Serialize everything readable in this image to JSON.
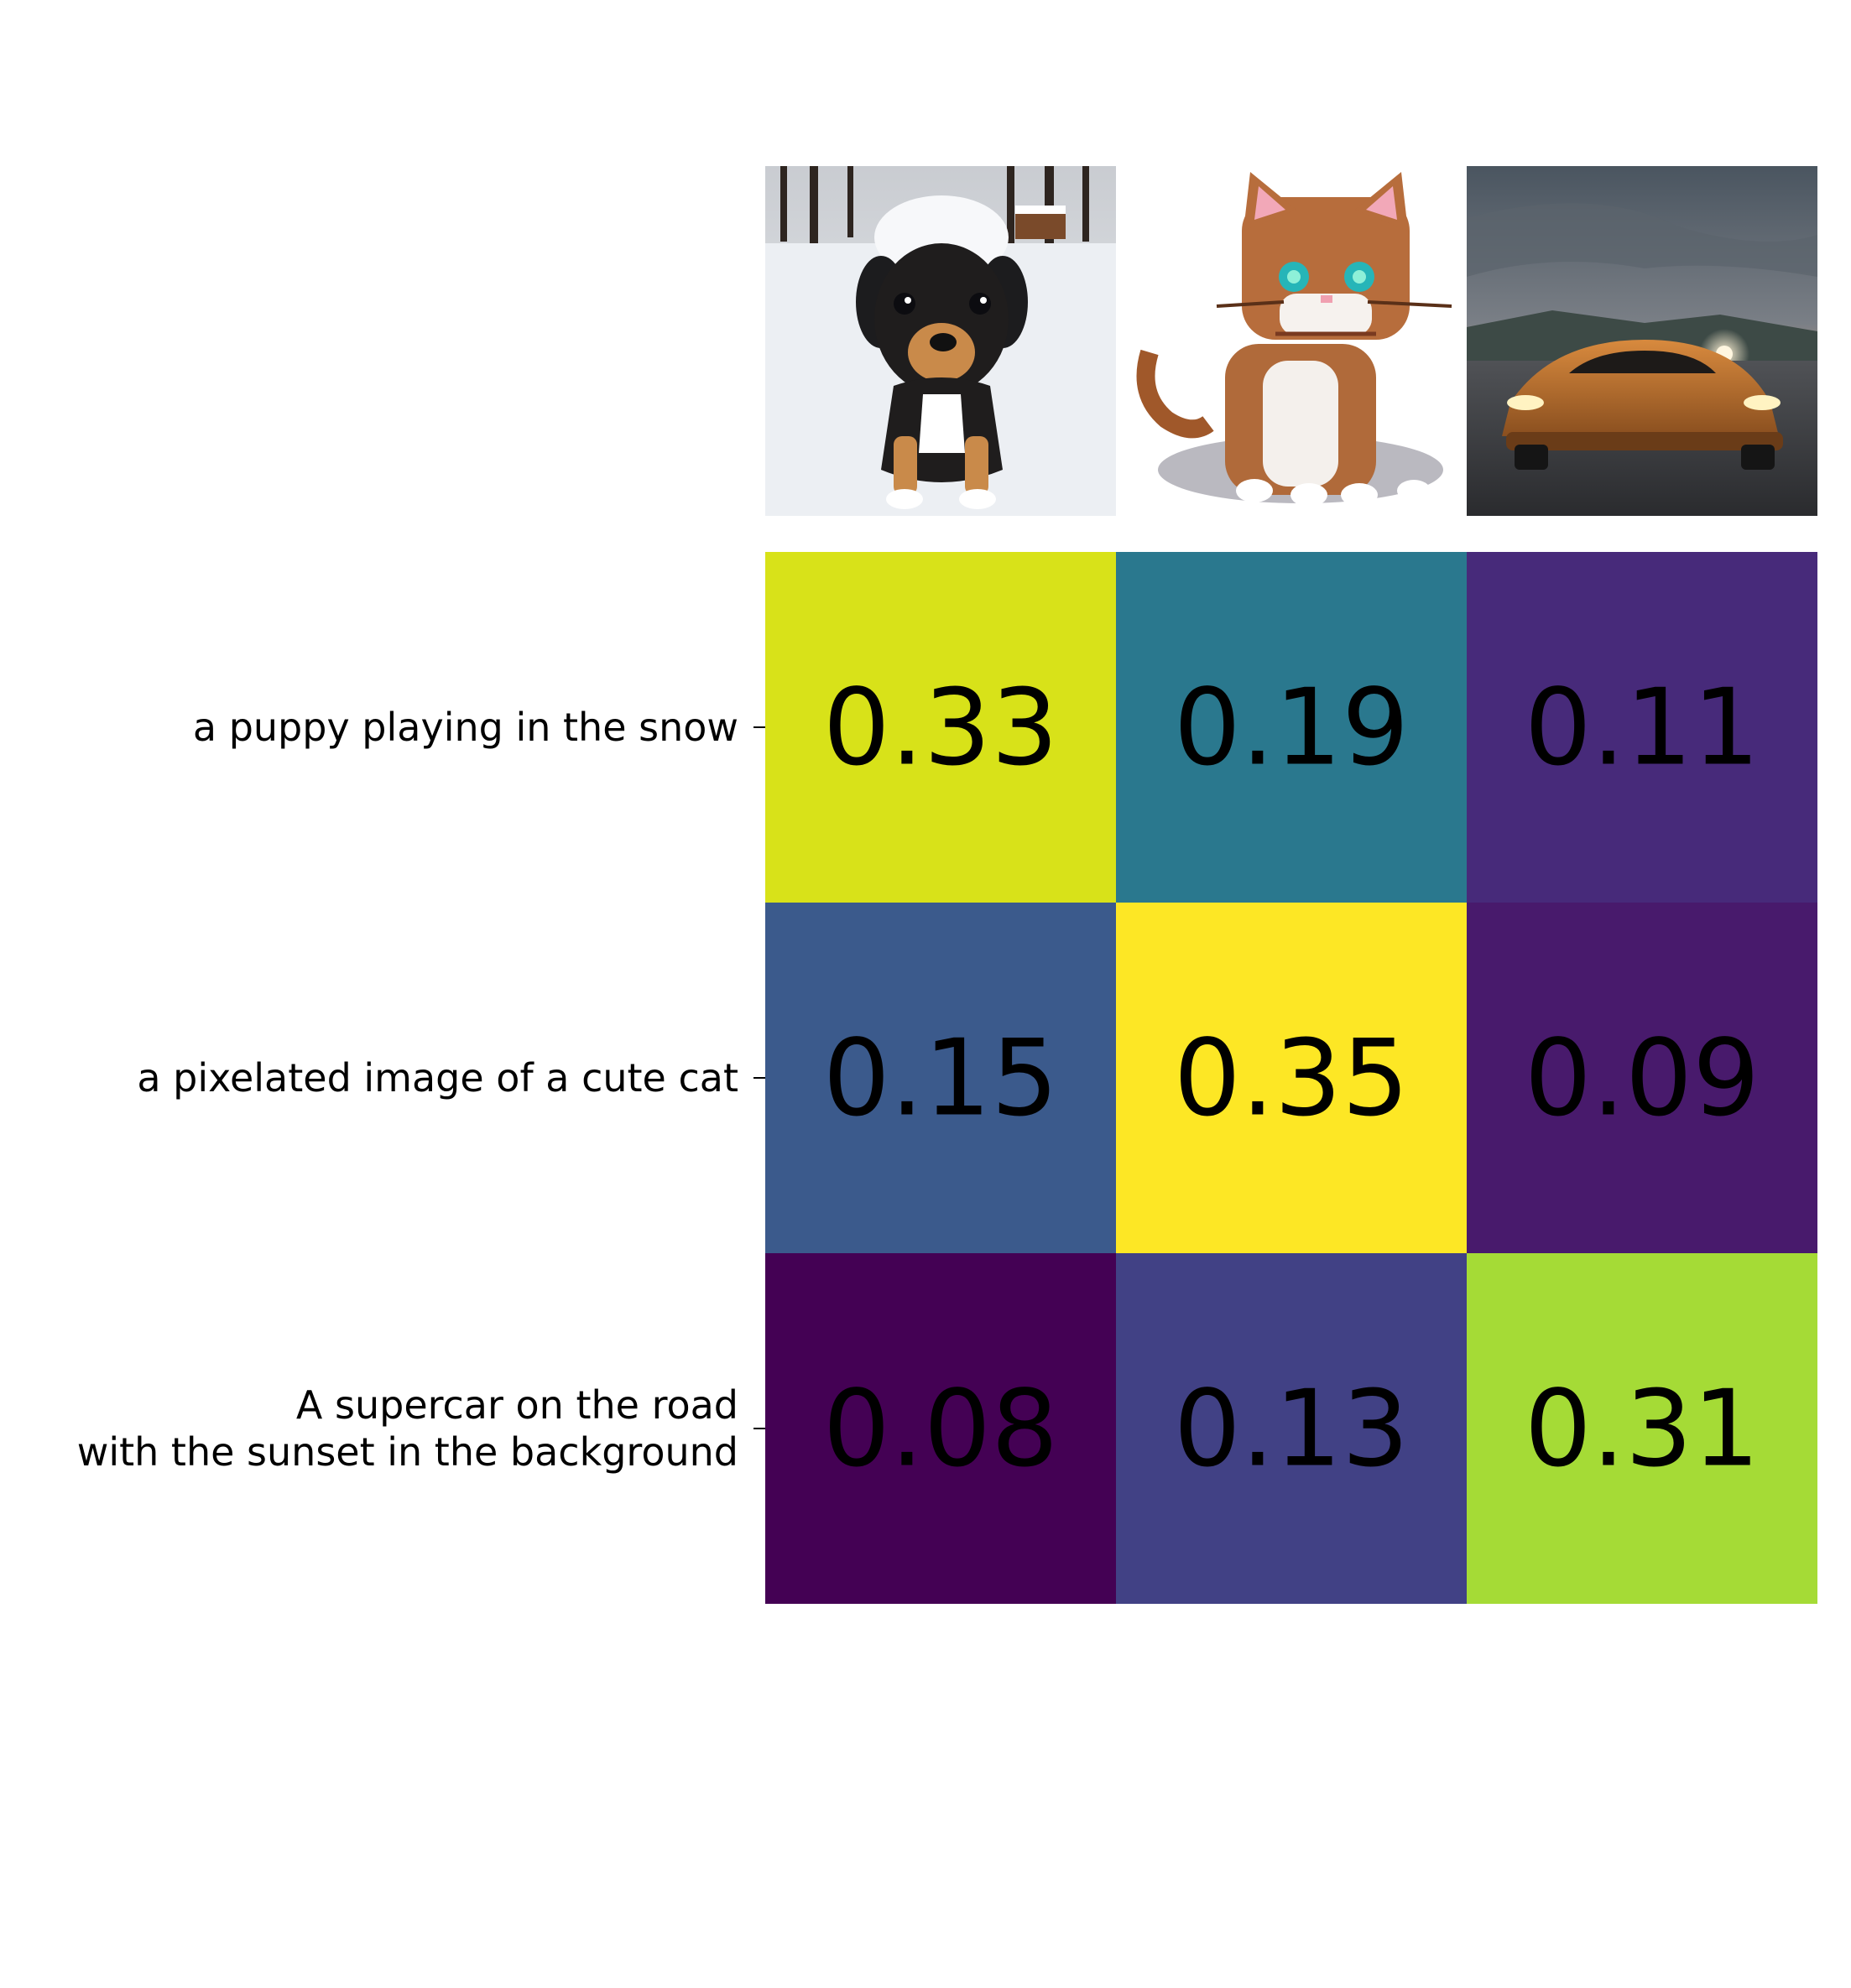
{
  "chart_data": {
    "type": "heatmap",
    "colormap": "viridis",
    "rows": [
      {
        "label_lines": [
          "a puppy playing in the snow"
        ]
      },
      {
        "label_lines": [
          "a pixelated image of a cute cat"
        ]
      },
      {
        "label_lines": [
          "A supercar on the road",
          "with the sunset in the background"
        ]
      }
    ],
    "columns": [
      {
        "image": "puppy-in-snow"
      },
      {
        "image": "pixel-art-cat"
      },
      {
        "image": "supercar-at-sunset"
      }
    ],
    "values": [
      [
        0.33,
        0.19,
        0.11
      ],
      [
        0.15,
        0.35,
        0.09
      ],
      [
        0.08,
        0.13,
        0.31
      ]
    ],
    "cell_colors": [
      [
        "#d8e219",
        "#2a788e",
        "#472a7a"
      ],
      [
        "#3b5a8c",
        "#fde725",
        "#481a6c"
      ],
      [
        "#440154",
        "#414185",
        "#a5db36"
      ]
    ],
    "text_color": "#000000"
  }
}
